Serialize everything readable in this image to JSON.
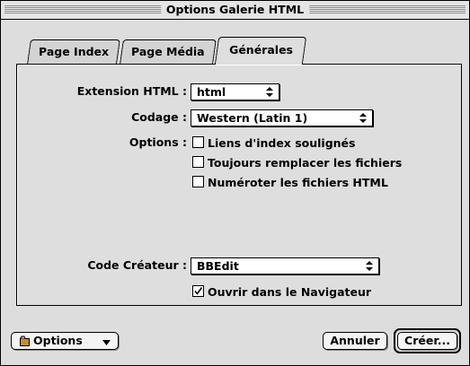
{
  "window": {
    "title": "Options Galerie HTML"
  },
  "tabs": [
    {
      "label": "Page Index"
    },
    {
      "label": "Page Média"
    },
    {
      "label": "Générales"
    }
  ],
  "general": {
    "extension_label": "Extension HTML :",
    "extension_value": "html",
    "encoding_label": "Codage :",
    "encoding_value": "Western (Latin 1)",
    "options_label": "Options :",
    "options": [
      {
        "label": "Liens d'index soulignés",
        "checked": false
      },
      {
        "label": "Toujours remplacer les fichiers",
        "checked": false
      },
      {
        "label": "Numéroter les fichiers HTML",
        "checked": false
      }
    ],
    "creator_label": "Code Créateur :",
    "creator_value": "BBEdit",
    "open_browser": {
      "label": "Ouvrir dans le Navigateur",
      "checked": true
    }
  },
  "footer": {
    "options_button": "Options",
    "cancel_button": "Annuler",
    "create_button": "Créer..."
  }
}
